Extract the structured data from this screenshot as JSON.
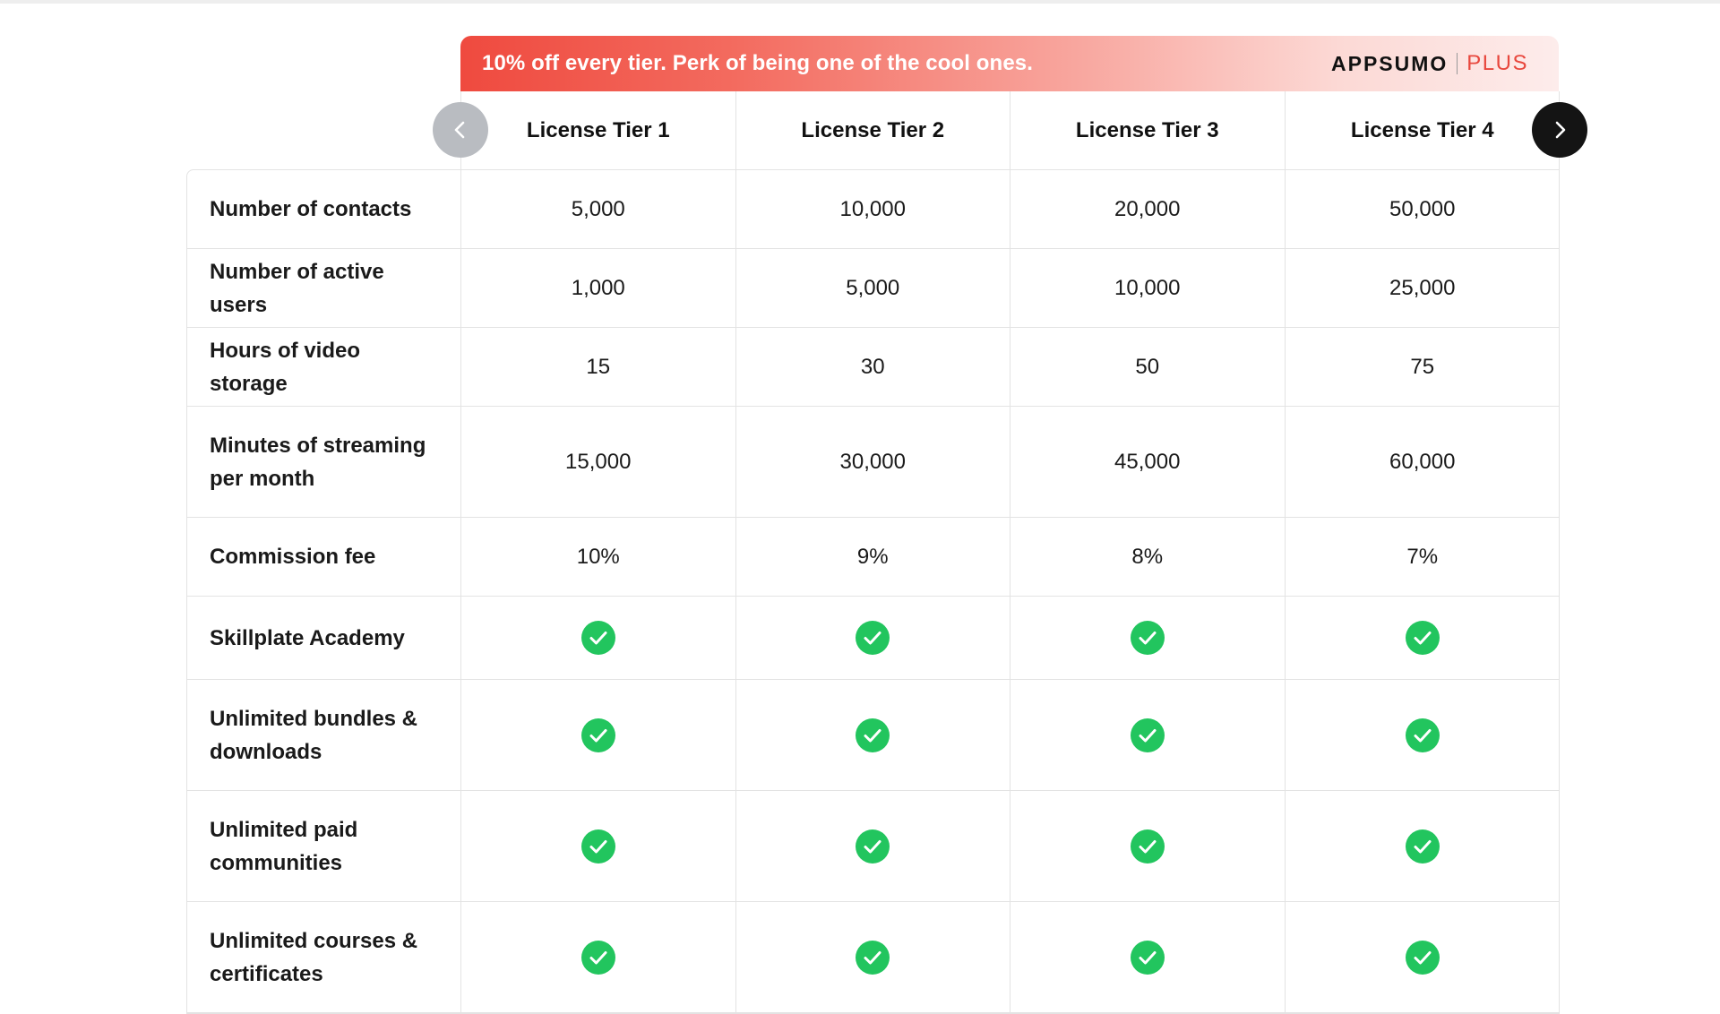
{
  "banner": {
    "text": "10% off every tier. Perk of being one of the cool ones.",
    "brand_main": "APPSUMO",
    "brand_plus": "PLUS"
  },
  "colors": {
    "accent_red": "#ef4a3f",
    "check_green": "#22c55e",
    "nav_prev_bg": "#b9bcc1",
    "nav_next_bg": "#141414"
  },
  "icons": {
    "prev": "chevron-left-icon",
    "next": "chevron-right-icon",
    "included": "check-circle-icon"
  },
  "tiers": [
    "License Tier 1",
    "License Tier 2",
    "License Tier 3",
    "License Tier 4"
  ],
  "rows": [
    {
      "label": "Number of contacts",
      "values": [
        "5,000",
        "10,000",
        "20,000",
        "50,000"
      ],
      "height": 88
    },
    {
      "label": "Number of active users",
      "values": [
        "1,000",
        "5,000",
        "10,000",
        "25,000"
      ],
      "height": 88
    },
    {
      "label": "Hours of video storage",
      "values": [
        "15",
        "30",
        "50",
        "75"
      ],
      "height": 88
    },
    {
      "label": "Minutes of streaming per month",
      "values": [
        "15,000",
        "30,000",
        "45,000",
        "60,000"
      ],
      "height": 124
    },
    {
      "label": "Commission fee",
      "values": [
        "10%",
        "9%",
        "8%",
        "7%"
      ],
      "height": 88
    },
    {
      "label": "Skillplate Academy",
      "values": [
        true,
        true,
        true,
        true
      ],
      "height": 93
    },
    {
      "label": "Unlimited bundles & downloads",
      "values": [
        true,
        true,
        true,
        true
      ],
      "height": 124
    },
    {
      "label": "Unlimited paid communities",
      "values": [
        true,
        true,
        true,
        true
      ],
      "height": 124
    },
    {
      "label": "Unlimited courses & certificates",
      "values": [
        true,
        true,
        true,
        true
      ],
      "height": 124
    }
  ]
}
